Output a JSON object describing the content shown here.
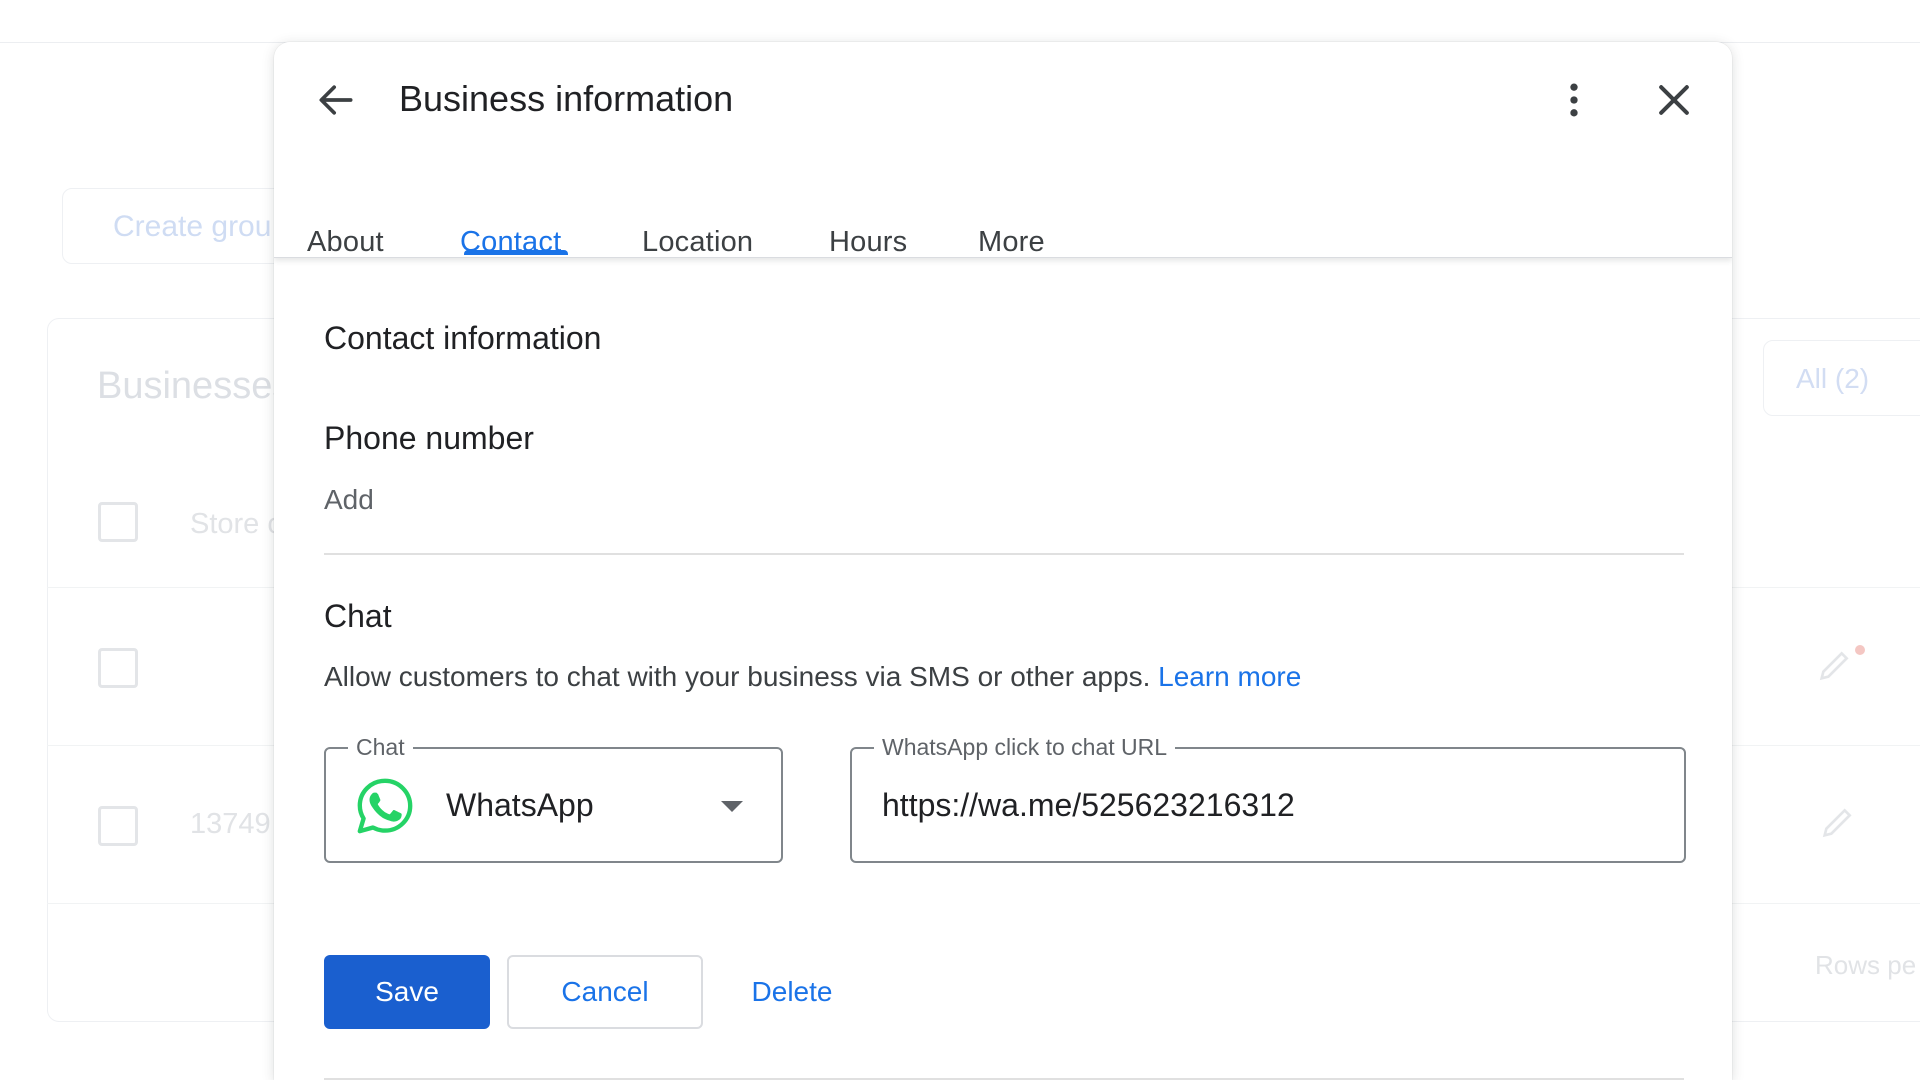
{
  "background": {
    "create_group": "Create grou",
    "card_title": "Businesses",
    "col_header": "Store c",
    "row2_code": "13749",
    "all_pill": "All (2)",
    "rows_per_page": "Rows pe"
  },
  "dialog": {
    "title": "Business information",
    "tabs": [
      {
        "label": "About",
        "active": false
      },
      {
        "label": "Contact",
        "active": true
      },
      {
        "label": "Location",
        "active": false
      },
      {
        "label": "Hours",
        "active": false
      },
      {
        "label": "More",
        "active": false
      }
    ],
    "icons": {
      "back": "arrow-back-icon",
      "more": "more-vert-icon",
      "close": "close-icon"
    }
  },
  "contact": {
    "section_title": "Contact information",
    "phone": {
      "label": "Phone number",
      "add_label": "Add"
    },
    "chat": {
      "label": "Chat",
      "description": "Allow customers to chat with your business via SMS or other apps.",
      "learn_more": "Learn more",
      "select_legend": "Chat",
      "select_value": "WhatsApp",
      "select_icon": "whatsapp-icon",
      "url_legend": "WhatsApp click to chat URL",
      "url_value": "https://wa.me/525623216312"
    }
  },
  "actions": {
    "save": "Save",
    "cancel": "Cancel",
    "delete": "Delete"
  },
  "colors": {
    "primary": "#1a73e8",
    "save_button": "#1a5fcf",
    "whatsapp_green": "#25d366"
  }
}
